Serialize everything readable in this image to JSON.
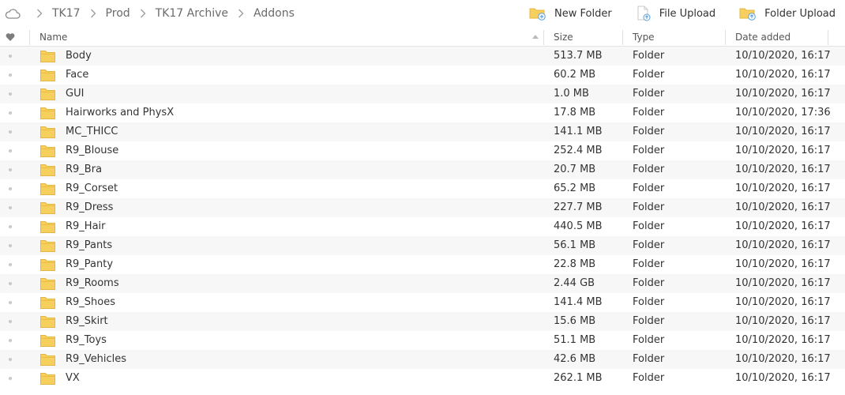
{
  "breadcrumb": [
    "TK17",
    "Prod",
    "TK17 Archive",
    "Addons"
  ],
  "actions": {
    "new_folder": "New Folder",
    "file_upload": "File Upload",
    "folder_upload": "Folder Upload"
  },
  "columns": {
    "name": "Name",
    "size": "Size",
    "type": "Type",
    "date": "Date added"
  },
  "colors": {
    "folder": "#f7cf5f",
    "folder_dark": "#e6b73e"
  },
  "rows": [
    {
      "name": "Body",
      "size": "513.7 MB",
      "type": "Folder",
      "date": "10/10/2020, 16:17"
    },
    {
      "name": "Face",
      "size": "60.2 MB",
      "type": "Folder",
      "date": "10/10/2020, 16:17"
    },
    {
      "name": "GUI",
      "size": "1.0 MB",
      "type": "Folder",
      "date": "10/10/2020, 16:17"
    },
    {
      "name": "Hairworks and PhysX",
      "size": "17.8 MB",
      "type": "Folder",
      "date": "10/10/2020, 17:36"
    },
    {
      "name": "MC_THICC",
      "size": "141.1 MB",
      "type": "Folder",
      "date": "10/10/2020, 16:17"
    },
    {
      "name": "R9_Blouse",
      "size": "252.4 MB",
      "type": "Folder",
      "date": "10/10/2020, 16:17"
    },
    {
      "name": "R9_Bra",
      "size": "20.7 MB",
      "type": "Folder",
      "date": "10/10/2020, 16:17"
    },
    {
      "name": "R9_Corset",
      "size": "65.2 MB",
      "type": "Folder",
      "date": "10/10/2020, 16:17"
    },
    {
      "name": "R9_Dress",
      "size": "227.7 MB",
      "type": "Folder",
      "date": "10/10/2020, 16:17"
    },
    {
      "name": "R9_Hair",
      "size": "440.5 MB",
      "type": "Folder",
      "date": "10/10/2020, 16:17"
    },
    {
      "name": "R9_Pants",
      "size": "56.1 MB",
      "type": "Folder",
      "date": "10/10/2020, 16:17"
    },
    {
      "name": "R9_Panty",
      "size": "22.8 MB",
      "type": "Folder",
      "date": "10/10/2020, 16:17"
    },
    {
      "name": "R9_Rooms",
      "size": "2.44 GB",
      "type": "Folder",
      "date": "10/10/2020, 16:17"
    },
    {
      "name": "R9_Shoes",
      "size": "141.4 MB",
      "type": "Folder",
      "date": "10/10/2020, 16:17"
    },
    {
      "name": "R9_Skirt",
      "size": "15.6 MB",
      "type": "Folder",
      "date": "10/10/2020, 16:17"
    },
    {
      "name": "R9_Toys",
      "size": "51.1 MB",
      "type": "Folder",
      "date": "10/10/2020, 16:17"
    },
    {
      "name": "R9_Vehicles",
      "size": "42.6 MB",
      "type": "Folder",
      "date": "10/10/2020, 16:17"
    },
    {
      "name": "VX",
      "size": "262.1 MB",
      "type": "Folder",
      "date": "10/10/2020, 16:17"
    }
  ]
}
